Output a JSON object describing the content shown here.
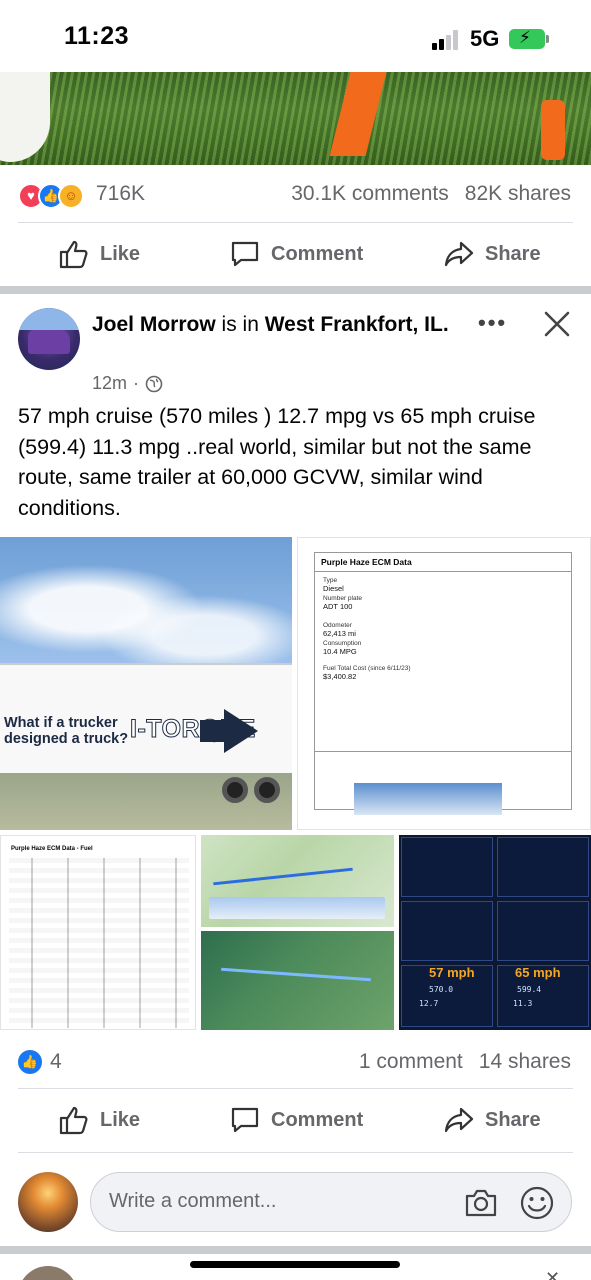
{
  "status_bar": {
    "time": "11:23",
    "network": "5G"
  },
  "prev_post": {
    "reactions_count": "716K",
    "comments": "30.1K comments",
    "shares": "82K shares"
  },
  "actions": {
    "like": "Like",
    "comment": "Comment",
    "share": "Share"
  },
  "post": {
    "author": "Joel Morrow",
    "connector": " is in ",
    "location": "West Frankfort, IL.",
    "time": "12m",
    "dot": "·",
    "text": "57 mph cruise (570 miles ) 12.7 mpg vs 65 mph cruise (599.4) 11.3 mpg ..real world, similar but not the same route, same trailer at 60,000 GCVW, similar wind conditions.",
    "media": {
      "trailer_slogan": "What if a trucker designed a truck?",
      "trailer_brand": "I-TORQUE",
      "ecm_doc": {
        "title": "Purple Haze ECM Data",
        "type_label": "Type",
        "type_value": "Diesel",
        "plate_label": "Number plate",
        "plate_value": "ADT 100",
        "odometer_label": "Odometer",
        "odometer_value": "62,413 mi",
        "consumption_label": "Consumption",
        "consumption_value": "10.4 MPG",
        "fuel_label": "Fuel Total Cost (since 6/11/23)",
        "fuel_value": "$3,400.82"
      },
      "fuel_table_title": "Purple Haze ECM Data - Fuel",
      "dash": {
        "trip2_57": "57 mph",
        "trip2_65": "65 mph",
        "distance_57": "570.0",
        "distance_65": "599.4",
        "mpg_57": "12.7",
        "mpg_65": "11.3"
      }
    },
    "reactions_count": "4",
    "comments": "1 comment",
    "shares": "14 shares"
  },
  "composer": {
    "placeholder": "Write a comment..."
  },
  "colors": {
    "facebook_blue": "#1877f2",
    "meta_gray": "#65676b",
    "divider": "#c9ccd1"
  },
  "icons": [
    "like-icon",
    "comment-icon",
    "share-icon",
    "globe-icon",
    "close-icon",
    "more-icon",
    "camera-icon",
    "emoji-icon"
  ]
}
